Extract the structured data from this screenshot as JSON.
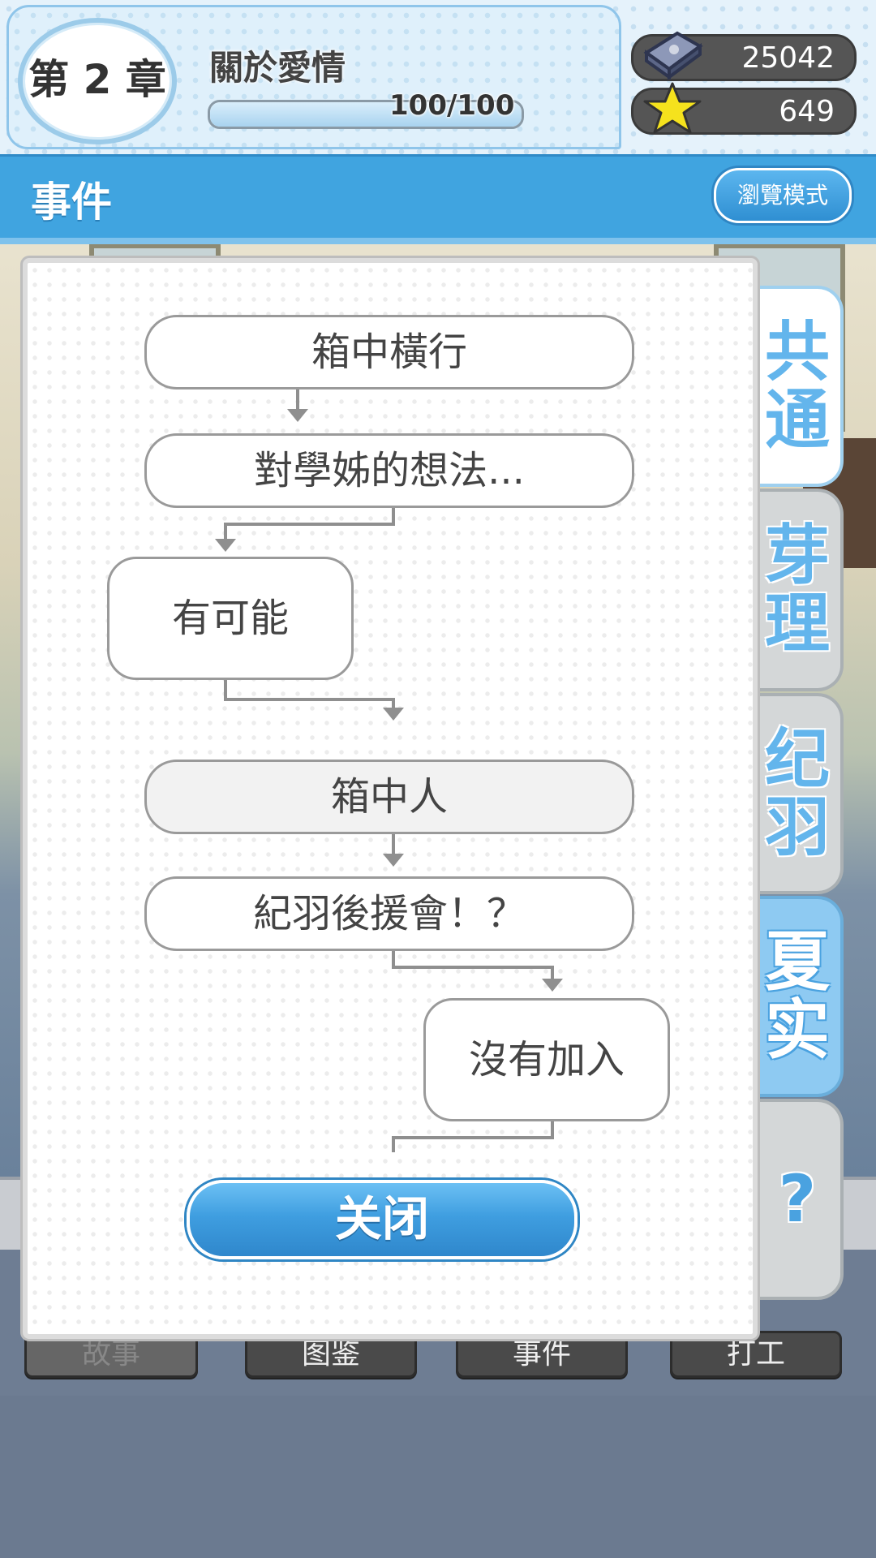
{
  "header": {
    "chapter_label": "第 2 章",
    "chapter_title": "關於愛情",
    "progress_text": "100/100",
    "progress_fraction": 1.0,
    "currency": [
      {
        "icon": "crystal-icon",
        "value": "25042"
      },
      {
        "icon": "star-icon",
        "value": "649"
      }
    ]
  },
  "titlebar": {
    "title": "事件",
    "browse_label": "瀏覽模式"
  },
  "side_tabs": [
    {
      "label": "共通",
      "state": "active"
    },
    {
      "label": "芽理",
      "state": "normal"
    },
    {
      "label": "纪羽",
      "state": "normal"
    },
    {
      "label": "夏实",
      "state": "highlight"
    },
    {
      "label": "?",
      "state": "normal"
    }
  ],
  "flowchart": {
    "nodes": [
      "箱中橫行",
      "對學姊的想法...",
      "有可能",
      "箱中人",
      "紀羽後援會！？",
      "沒有加入"
    ]
  },
  "close_label": "关闭",
  "bottom_nav": [
    "故事",
    "图鉴",
    "事件",
    "打工"
  ]
}
